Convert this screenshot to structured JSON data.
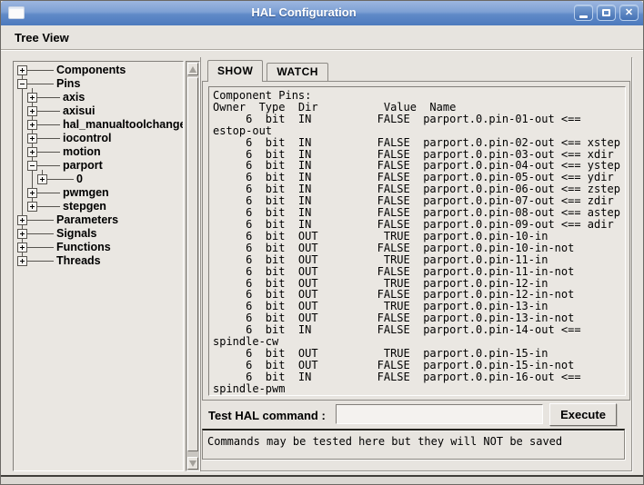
{
  "colors": {
    "window_bg": "#e7e4df",
    "titlebar_top": "#9db7e0",
    "titlebar_bottom": "#4d7abd",
    "titlebar_text": "#ffffff",
    "text_color": "#000000"
  },
  "window": {
    "title": "HAL Configuration",
    "controls": [
      {
        "name": "minimize",
        "glyph": "minimize"
      },
      {
        "name": "maximize",
        "glyph": "maximize"
      },
      {
        "name": "close",
        "glyph": "✕"
      }
    ]
  },
  "menubar": {
    "items": [
      "Tree View"
    ]
  },
  "tree": {
    "items": [
      {
        "label": "Components",
        "depth": 0,
        "state": "collapsed"
      },
      {
        "label": "Pins",
        "depth": 0,
        "state": "expanded"
      },
      {
        "label": "axis",
        "depth": 1,
        "state": "collapsed"
      },
      {
        "label": "axisui",
        "depth": 1,
        "state": "collapsed"
      },
      {
        "label": "hal_manualtoolchange",
        "depth": 1,
        "state": "collapsed"
      },
      {
        "label": "iocontrol",
        "depth": 1,
        "state": "collapsed"
      },
      {
        "label": "motion",
        "depth": 1,
        "state": "collapsed"
      },
      {
        "label": "parport",
        "depth": 1,
        "state": "expanded"
      },
      {
        "label": "0",
        "depth": 2,
        "state": "collapsed"
      },
      {
        "label": "pwmgen",
        "depth": 1,
        "state": "collapsed"
      },
      {
        "label": "stepgen",
        "depth": 1,
        "state": "collapsed"
      },
      {
        "label": "Parameters",
        "depth": 0,
        "state": "collapsed"
      },
      {
        "label": "Signals",
        "depth": 0,
        "state": "collapsed"
      },
      {
        "label": "Functions",
        "depth": 0,
        "state": "collapsed"
      },
      {
        "label": "Threads",
        "depth": 0,
        "state": "collapsed"
      }
    ]
  },
  "tabs": [
    {
      "label": "SHOW",
      "active": true
    },
    {
      "label": "WATCH",
      "active": false
    }
  ],
  "show_output": {
    "title_line": "Component Pins:",
    "columns": [
      "Owner",
      "Type",
      "Dir",
      "Value",
      "Name"
    ],
    "lines": [
      "Component Pins:",
      "Owner  Type  Dir          Value  Name",
      "     6  bit  IN          FALSE  parport.0.pin-01-out <==",
      "estop-out",
      "     6  bit  IN          FALSE  parport.0.pin-02-out <== xstep",
      "     6  bit  IN          FALSE  parport.0.pin-03-out <== xdir",
      "     6  bit  IN          FALSE  parport.0.pin-04-out <== ystep",
      "     6  bit  IN          FALSE  parport.0.pin-05-out <== ydir",
      "     6  bit  IN          FALSE  parport.0.pin-06-out <== zstep",
      "     6  bit  IN          FALSE  parport.0.pin-07-out <== zdir",
      "     6  bit  IN          FALSE  parport.0.pin-08-out <== astep",
      "     6  bit  IN          FALSE  parport.0.pin-09-out <== adir",
      "     6  bit  OUT          TRUE  parport.0.pin-10-in",
      "     6  bit  OUT         FALSE  parport.0.pin-10-in-not",
      "     6  bit  OUT          TRUE  parport.0.pin-11-in",
      "     6  bit  OUT         FALSE  parport.0.pin-11-in-not",
      "     6  bit  OUT          TRUE  parport.0.pin-12-in",
      "     6  bit  OUT         FALSE  parport.0.pin-12-in-not",
      "     6  bit  OUT          TRUE  parport.0.pin-13-in",
      "     6  bit  OUT         FALSE  parport.0.pin-13-in-not",
      "     6  bit  IN          FALSE  parport.0.pin-14-out <==",
      "spindle-cw",
      "     6  bit  OUT          TRUE  parport.0.pin-15-in",
      "     6  bit  OUT         FALSE  parport.0.pin-15-in-not",
      "     6  bit  IN          FALSE  parport.0.pin-16-out <==",
      "spindle-pwm"
    ]
  },
  "command_bar": {
    "label": "Test HAL command :",
    "input_value": "",
    "execute_label": "Execute"
  },
  "message_box": {
    "text": "Commands may be tested here but they will NOT be saved"
  }
}
